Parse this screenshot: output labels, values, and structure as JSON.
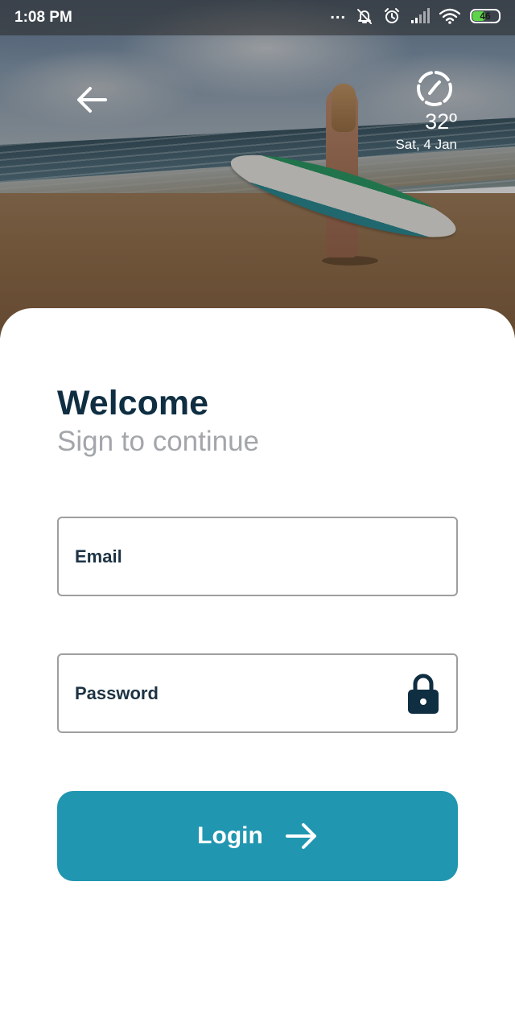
{
  "status_bar": {
    "time": "1:08 PM",
    "dots": "...",
    "battery_level": "46",
    "battery_fraction": 0.46,
    "icons": [
      "dots-icon",
      "muted-bell-icon",
      "alarm-icon",
      "signal-icon",
      "wifi-icon",
      "battery-icon"
    ]
  },
  "header": {
    "back_icon": "arrow-left-icon",
    "weather_icon": "dashed-compass-icon",
    "temperature": "32º",
    "date": "Sat, 4 Jan"
  },
  "login": {
    "title": "Welcome",
    "subtitle": "Sign to continue",
    "email_placeholder": "Email",
    "password_placeholder": "Password",
    "password_icon": "lock-icon",
    "button_label": "Login",
    "button_icon": "arrow-right-icon"
  },
  "colors": {
    "title": "#0f2e42",
    "subtitle": "#a3a6aa",
    "accent": "#2196b0",
    "field_border": "#9e9e9e",
    "battery": "#5fd34a"
  }
}
